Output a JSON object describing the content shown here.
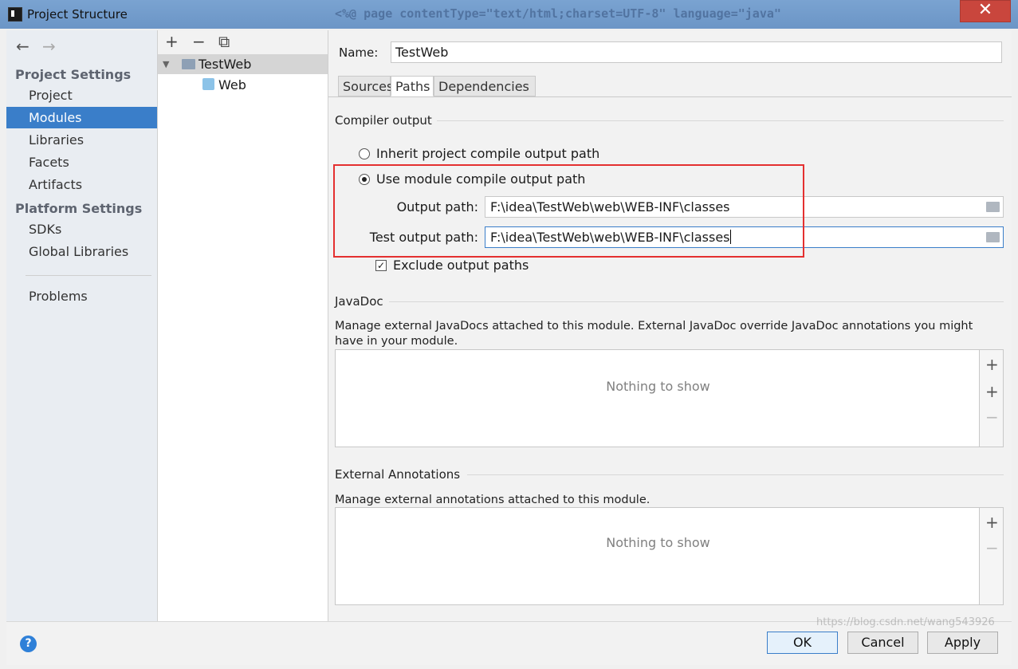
{
  "window": {
    "title": "Project Structure",
    "background_text": "<%@ page contentType=\"text/html;charset=UTF-8\" language=\"java\"",
    "close_glyph": "✕"
  },
  "nav": {
    "back_icon": "←",
    "forward_icon": "→",
    "project_settings_header": "Project Settings",
    "project_settings": [
      "Project",
      "Modules",
      "Libraries",
      "Facets",
      "Artifacts"
    ],
    "platform_settings_header": "Platform Settings",
    "platform_settings": [
      "SDKs",
      "Global Libraries"
    ],
    "problems": "Problems",
    "selected": "Modules"
  },
  "modules_toolbar": {
    "add": "+",
    "remove": "−",
    "copy": "⧉"
  },
  "tree": {
    "root": "TestWeb",
    "child": "Web"
  },
  "module": {
    "name_label": "Name:",
    "name_value": "TestWeb",
    "tabs": [
      "Sources",
      "Paths",
      "Dependencies"
    ],
    "active_tab": "Paths"
  },
  "compiler_output": {
    "title": "Compiler output",
    "inherit_label": "Inherit project compile output path",
    "use_module_label": "Use module compile output path",
    "output_path_label": "Output path:",
    "output_path_value": "F:\\idea\\TestWeb\\web\\WEB-INF\\classes",
    "test_output_path_label": "Test output path:",
    "test_output_path_value": "F:\\idea\\TestWeb\\web\\WEB-INF\\classes",
    "exclude_label": "Exclude output paths",
    "exclude_checked": true
  },
  "javadoc": {
    "title": "JavaDoc",
    "description": "Manage external JavaDocs attached to this module. External JavaDoc override JavaDoc annotations you might have in your module.",
    "empty_text": "Nothing to show"
  },
  "external_annotations": {
    "title": "External Annotations",
    "description": "Manage external annotations attached to this module.",
    "empty_text": "Nothing to show"
  },
  "buttons": {
    "help": "?",
    "ok": "OK",
    "cancel": "Cancel",
    "apply": "Apply"
  },
  "watermark": "https://blog.csdn.net/wang543926",
  "colors": {
    "selection": "#3a7ec9",
    "highlight_box": "#e43030",
    "title_bar": "#6b95c6"
  }
}
